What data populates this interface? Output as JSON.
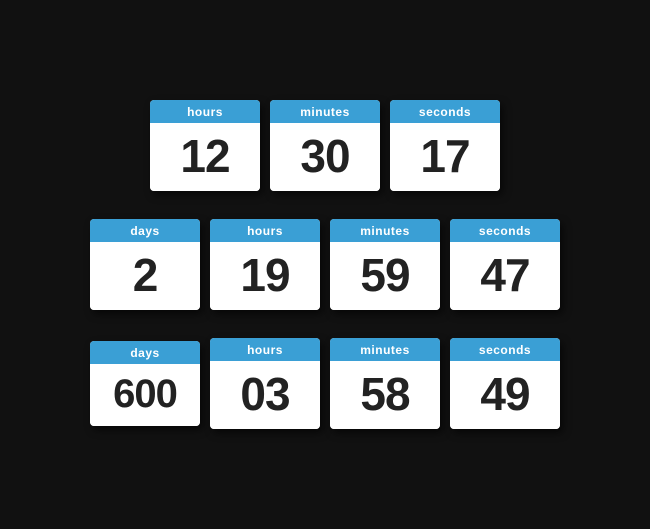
{
  "rows": [
    {
      "tiles": [
        {
          "label": "hours",
          "value": "12"
        },
        {
          "label": "minutes",
          "value": "30"
        },
        {
          "label": "seconds",
          "value": "17"
        }
      ]
    },
    {
      "tiles": [
        {
          "label": "days",
          "value": "2"
        },
        {
          "label": "hours",
          "value": "19"
        },
        {
          "label": "minutes",
          "value": "59"
        },
        {
          "label": "seconds",
          "value": "47"
        }
      ]
    },
    {
      "tiles": [
        {
          "label": "days",
          "value": "600"
        },
        {
          "label": "hours",
          "value": "03"
        },
        {
          "label": "minutes",
          "value": "58"
        },
        {
          "label": "seconds",
          "value": "49"
        }
      ]
    }
  ]
}
